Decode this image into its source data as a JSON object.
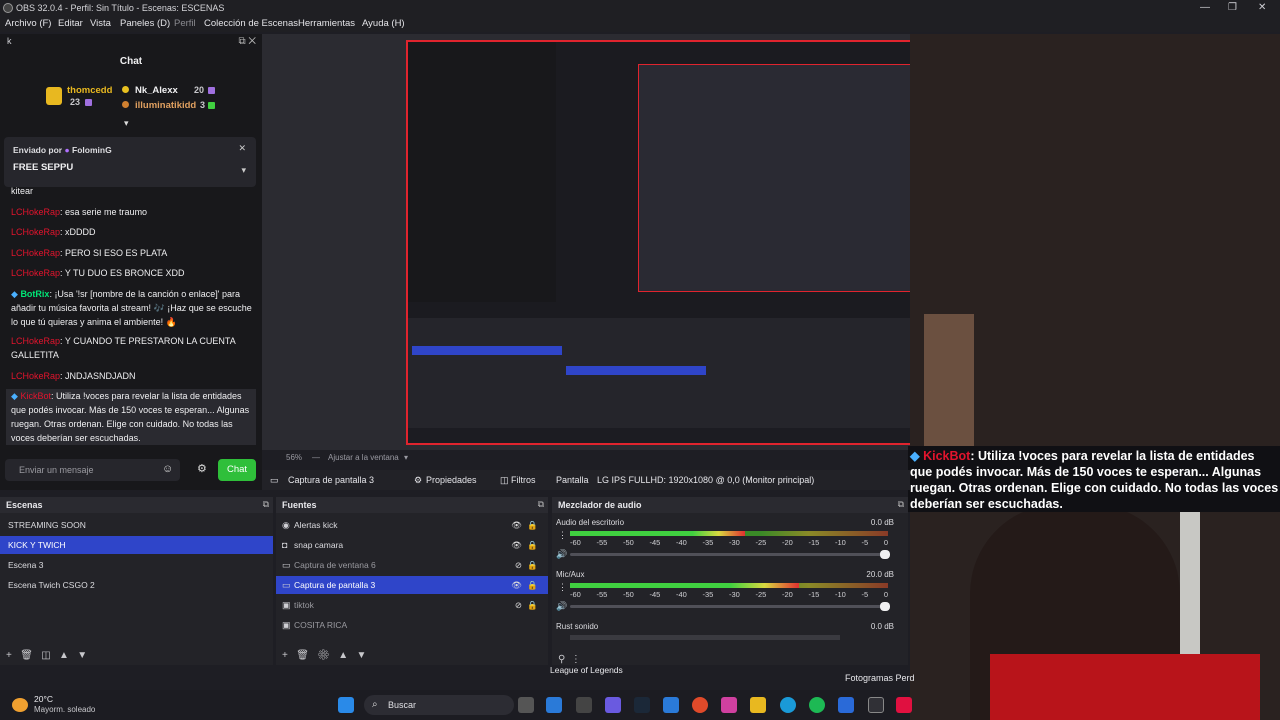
{
  "window": {
    "title": "OBS 32.0.4 - Perfil: Sin Título - Escenas: ESCENAS",
    "controls": [
      "—",
      "❐",
      "✕"
    ]
  },
  "menu": {
    "items": [
      "Archivo (F)",
      "Editar",
      "Vista",
      "Paneles (D)",
      "Perfil",
      "Colección de Escenas",
      "Herramientas",
      "Ayuda (H)"
    ]
  },
  "chat": {
    "search": "k",
    "title": "Chat",
    "gifters": [
      {
        "name": "thomcedd",
        "count": "23"
      },
      {
        "name": "Nk_Alexx",
        "count": "20"
      },
      {
        "name": "illuminatikidd",
        "count": "3"
      }
    ],
    "pinned": {
      "by_prefix": "Enviado por",
      "by_user": "FolominG",
      "message": "FREE SEPPU"
    },
    "first_fragment": "kitear",
    "messages": [
      {
        "user": "LCHokeRap",
        "text": ": esa serie me traumo"
      },
      {
        "user": "LCHokeRap",
        "text": ": xDDDD"
      },
      {
        "user": "LCHokeRap",
        "text": ": PERO SI ESO ES PLATA"
      },
      {
        "user": "LCHokeRap",
        "text": ": Y TU DUO ES BRONCE XDD"
      },
      {
        "user": "BotRix",
        "text": ": ¡Usa '!sr [nombre de la canción o enlace]' para añadir tu música favorita al stream! 🎶 ¡Haz que se escuche lo que tú quieras y anima el ambiente! 🔥"
      },
      {
        "user": "LCHokeRap",
        "text": ": Y CUANDO TE PRESTARON LA CUENTA GALLETITA"
      },
      {
        "user": "LCHokeRap",
        "text": ": JNDJASNDJADN"
      },
      {
        "user": "KickBot",
        "text": ": Utiliza !voces para revelar la lista de entidades que podés invocar. Más de 150 voces te esperan... Algunas ruegan. Otras ordenan. Elige con cuidado. No todas las voces deberían ser escuchadas."
      }
    ],
    "input_placeholder": "Enviar un mensaje",
    "send_label": "Chat"
  },
  "preview": {
    "zoom": "56%",
    "fit_label": "Ajustar a la ventana"
  },
  "overlay": {
    "user": "KickBot",
    "text": ": Utiliza !voces para revelar la lista de entidades que podés invocar. Más de 150 voces te esperan... Algunas ruegan. Otras ordenan. Elige con cuidado. No todas las voces deberían ser escuchadas."
  },
  "controls": {
    "selected_source": "Captura de pantalla 3",
    "properties": "Propiedades",
    "filters": "Filtros",
    "display_label": "Pantalla",
    "display_value": "LG IPS FULLHD: 1920x1080 @ 0,0 (Monitor principal)"
  },
  "scenes": {
    "title": "Escenas",
    "items": [
      "STREAMING SOON",
      "KICK Y TWICH",
      "Escena 3",
      "Escena Twich CSGO 2"
    ],
    "selected": 1
  },
  "sources": {
    "title": "Fuentes",
    "items": [
      {
        "name": "Alertas kick",
        "visible": true
      },
      {
        "name": "snap camara",
        "visible": true
      },
      {
        "name": "Captura de ventana 6",
        "visible": false
      },
      {
        "name": "Captura de pantalla 3",
        "visible": true
      },
      {
        "name": "tiktok",
        "visible": false
      },
      {
        "name": "COSITA RICA",
        "visible": false
      }
    ],
    "selected": 3
  },
  "mixer": {
    "title": "Mezclador de audio",
    "channels": [
      {
        "name": "Audio del escritorio",
        "db": "0.0 dB",
        "level": 0.55
      },
      {
        "name": "Mic/Aux",
        "db": "20.0 dB",
        "level": 0.72
      },
      {
        "name": "Rust sonido",
        "db": "0.0 dB",
        "level": 0
      }
    ],
    "scale": [
      "-60",
      "-55",
      "-50",
      "-45",
      "-40",
      "-35",
      "-30",
      "-25",
      "-20",
      "-15",
      "-10",
      "-5",
      "0"
    ]
  },
  "status": {
    "game": "League of Legends",
    "frames": "Fotogramas Perd"
  },
  "taskbar": {
    "temp": "20°C",
    "weather": "Mayorm. soleado",
    "search": "Buscar"
  },
  "colors": {
    "accent": "#2f45c9",
    "kick_green": "#2fbf3a",
    "alert_red": "#e0242e"
  }
}
